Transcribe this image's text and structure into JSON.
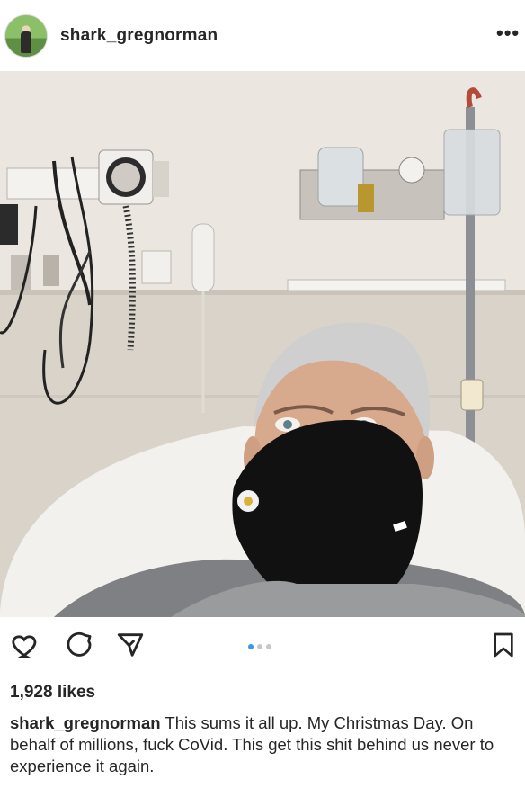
{
  "post": {
    "username": "shark_gregnorman",
    "likes": "1,928 likes",
    "caption_user": "shark_gregnorman",
    "caption_text": "This sums it all up. My Christmas Day. On behalf of millions, fuck CoVid. This get this shit behind us never to experience it again.",
    "carousel": {
      "count": 3,
      "active": 1
    }
  },
  "icons": {
    "more": "more-options-icon",
    "like": "heart-icon",
    "comment": "comment-icon",
    "share": "send-icon",
    "save": "bookmark-icon"
  },
  "colors": {
    "text": "#262626",
    "accent": "#3897f0",
    "mask": "#111111"
  }
}
